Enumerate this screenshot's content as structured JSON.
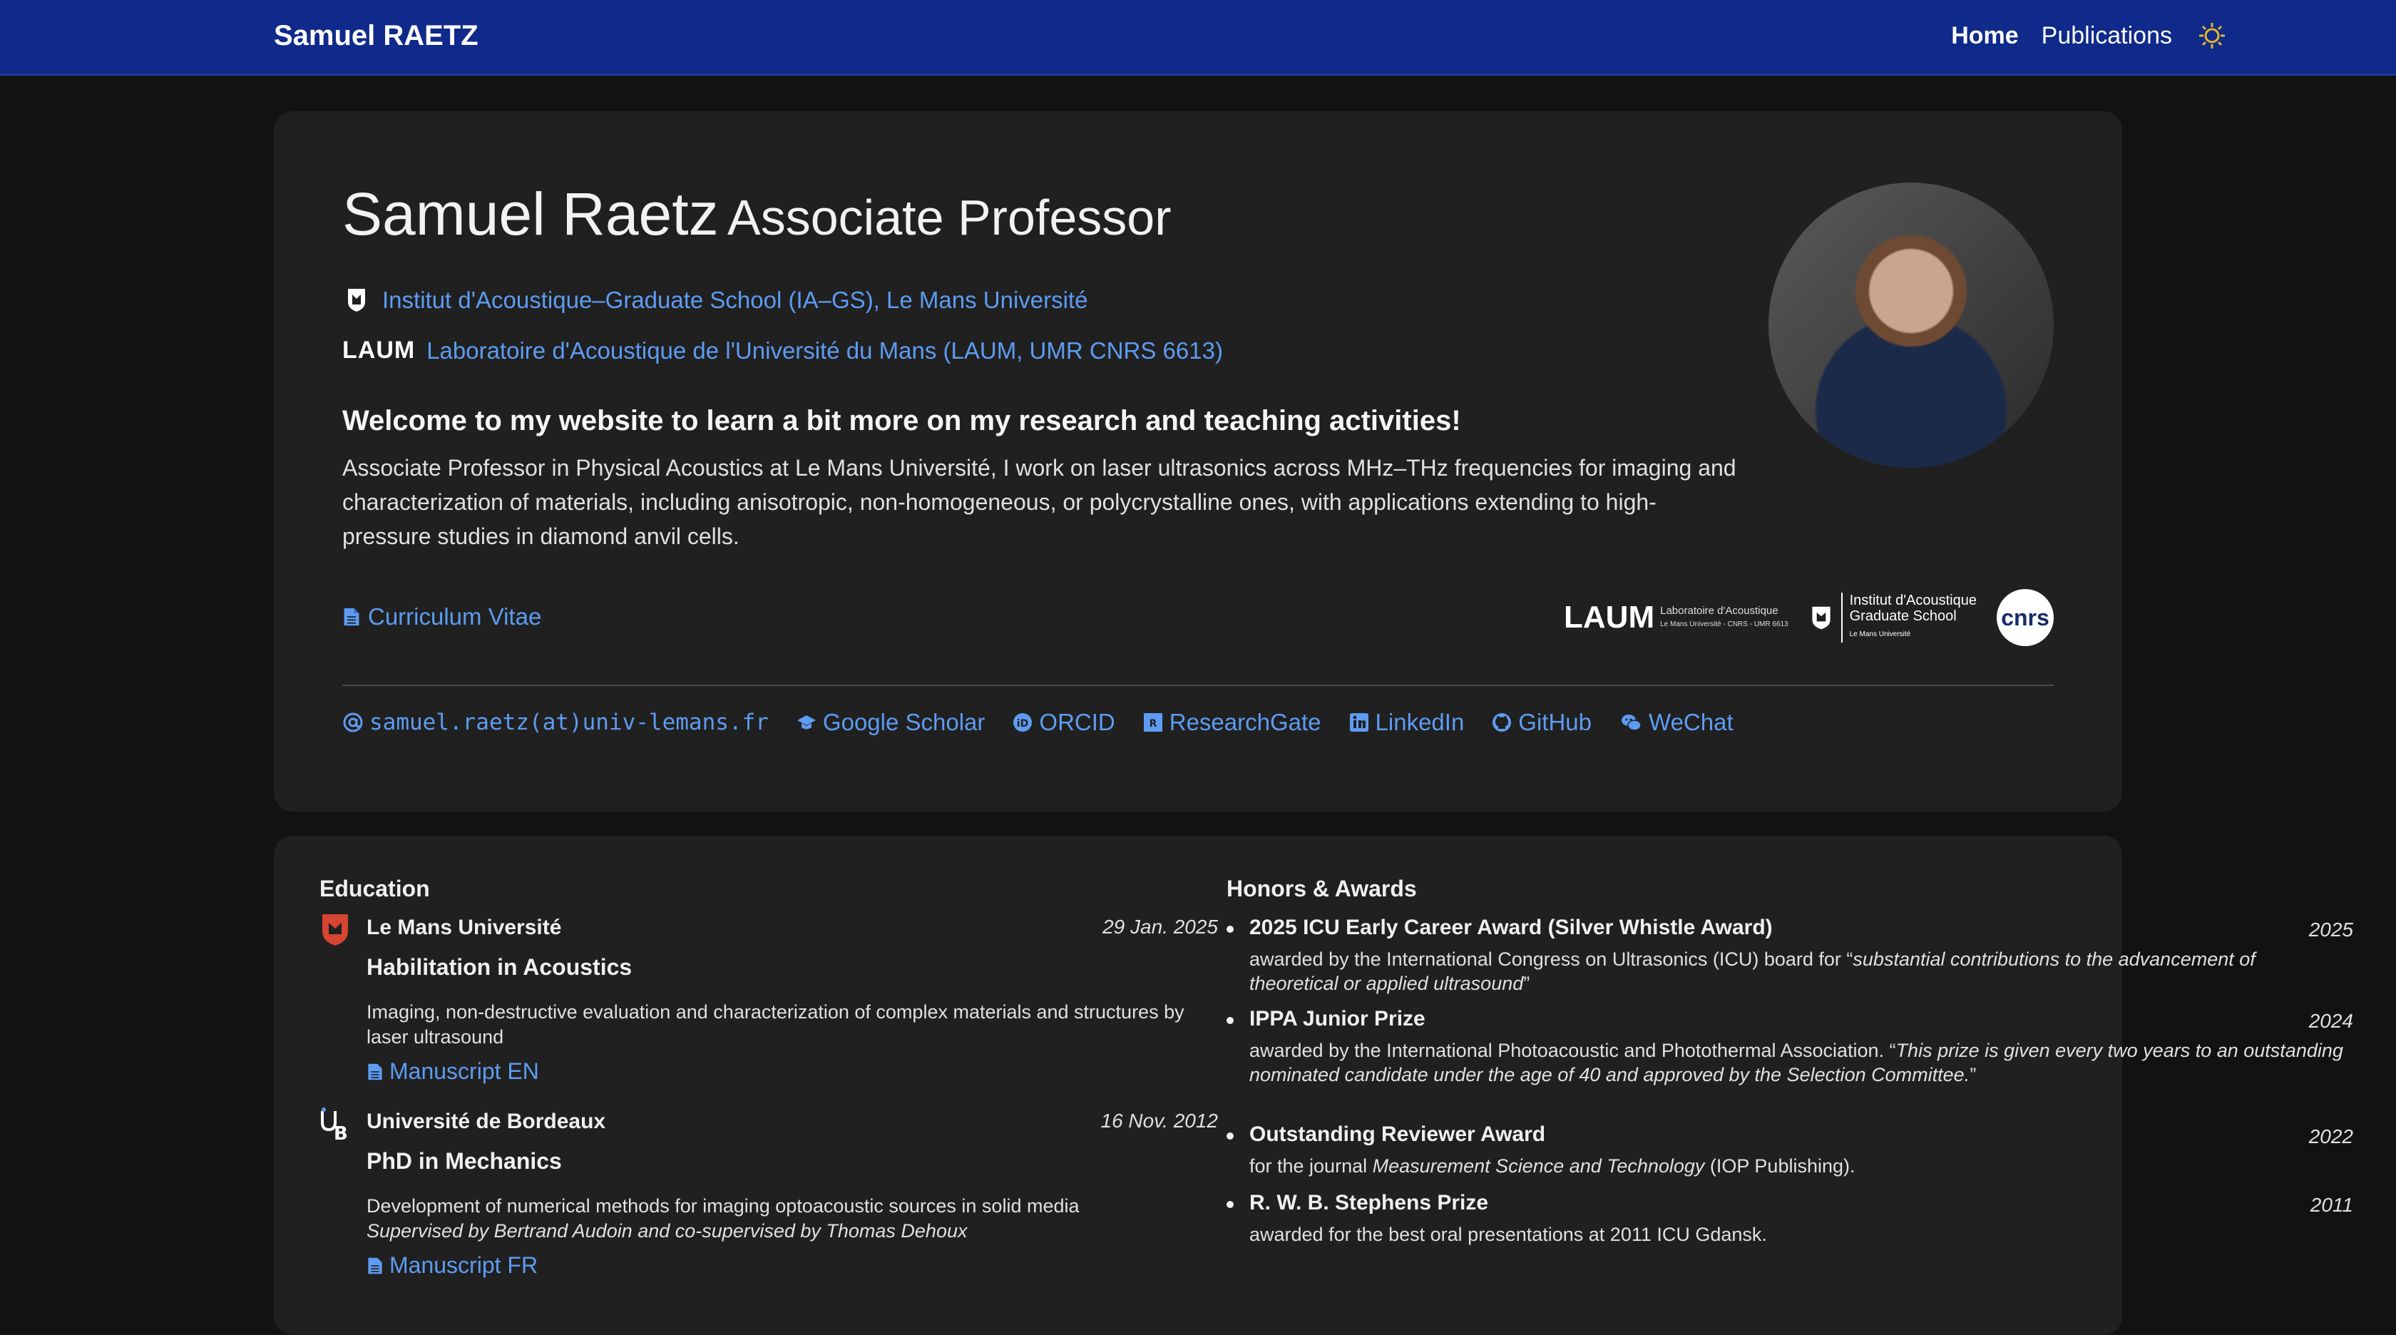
{
  "navbar": {
    "brand": "Samuel RAETZ",
    "links": [
      {
        "label": "Home",
        "active": true
      },
      {
        "label": "Publications",
        "active": false
      }
    ],
    "theme_icon": "sun-icon"
  },
  "profile": {
    "name": "Samuel Raetz",
    "title": "Associate Professor",
    "affiliations": [
      {
        "logo": "IA-GS",
        "text": "Institut d'Acoustique–Graduate School (IA–GS), Le Mans Université"
      },
      {
        "logo": "LAUM",
        "text": "Laboratoire d'Acoustique de l'Université du Mans (LAUM, UMR CNRS 6613)"
      }
    ],
    "welcome": "Welcome to my website to learn a bit more on my research and teaching activities!",
    "bio": "Associate Professor in Physical Acoustics at Le Mans Université, I work on laser ultrasonics across MHz–THz frequencies for imaging and characterization of materials, including anisotropic, non-homogeneous, or polycrystalline ones, with applications extending to high-pressure studies in diamond anvil cells.",
    "cv_label": "Curriculum Vitae",
    "partner_logos": {
      "laum_big": "LAUM",
      "laum_small_1": "Laboratoire d'Acoustique",
      "laum_small_2": "Le Mans Université - CNRS - UMR 6613",
      "ia_line1": "Institut d'Acoustique",
      "ia_line2": "Graduate School",
      "ia_line3": "Le Mans Université",
      "cnrs": "cnrs"
    },
    "social": [
      {
        "icon": "at-icon",
        "label": "samuel.raetz(at)univ-lemans.fr",
        "mono": true
      },
      {
        "icon": "graduation-cap-icon",
        "label": "Google Scholar"
      },
      {
        "icon": "orcid-icon",
        "label": "ORCID"
      },
      {
        "icon": "researchgate-icon",
        "label": "ResearchGate"
      },
      {
        "icon": "linkedin-icon",
        "label": "LinkedIn"
      },
      {
        "icon": "github-icon",
        "label": "GitHub"
      },
      {
        "icon": "wechat-icon",
        "label": "WeChat"
      }
    ]
  },
  "education": {
    "title": "Education",
    "items": [
      {
        "institution": "Le Mans Université",
        "date": "29 Jan. 2025",
        "degree": "Habilitation in Acoustics",
        "description": "Imaging, non-destructive evaluation and characterization of complex materials and structures by laser ultrasound",
        "supervision": "",
        "link": "Manuscript EN"
      },
      {
        "institution": "Université de Bordeaux",
        "date": "16 Nov. 2012",
        "degree": "PhD in Mechanics",
        "description": "Development of numerical methods for imaging optoacoustic sources in solid media",
        "supervision": "Supervised by Bertrand Audoin and co-supervised by Thomas Dehoux",
        "link": "Manuscript FR"
      }
    ]
  },
  "honors": {
    "title": "Honors & Awards",
    "items": [
      {
        "name": "2025 ICU Early Career Award (Silver Whistle Award)",
        "year": "2025",
        "desc_plain": "awarded by the International Congress on Ultrasonics (ICU) board for “",
        "desc_italic": "substantial contributions to the advancement of theoretical or applied ultrasound",
        "desc_end": "”"
      },
      {
        "name": "IPPA Junior Prize",
        "year": "2024",
        "desc_plain": "awarded by the International Photoacoustic and Photothermal Association. “",
        "desc_italic": "This prize is given every two years to an outstanding nominated candidate under the age of 40 and approved by the Selection Committee.",
        "desc_end": "”"
      },
      {
        "name": "Outstanding Reviewer Award",
        "year": "2022",
        "desc_plain": "for the journal ",
        "desc_italic": "Measurement Science and Technology",
        "desc_end": " (IOP Publishing)."
      },
      {
        "name": "R. W. B. Stephens Prize",
        "year": "2011",
        "desc_plain": "awarded for the best oral presentations at 2011 ICU Gdansk.",
        "desc_italic": "",
        "desc_end": ""
      }
    ]
  }
}
